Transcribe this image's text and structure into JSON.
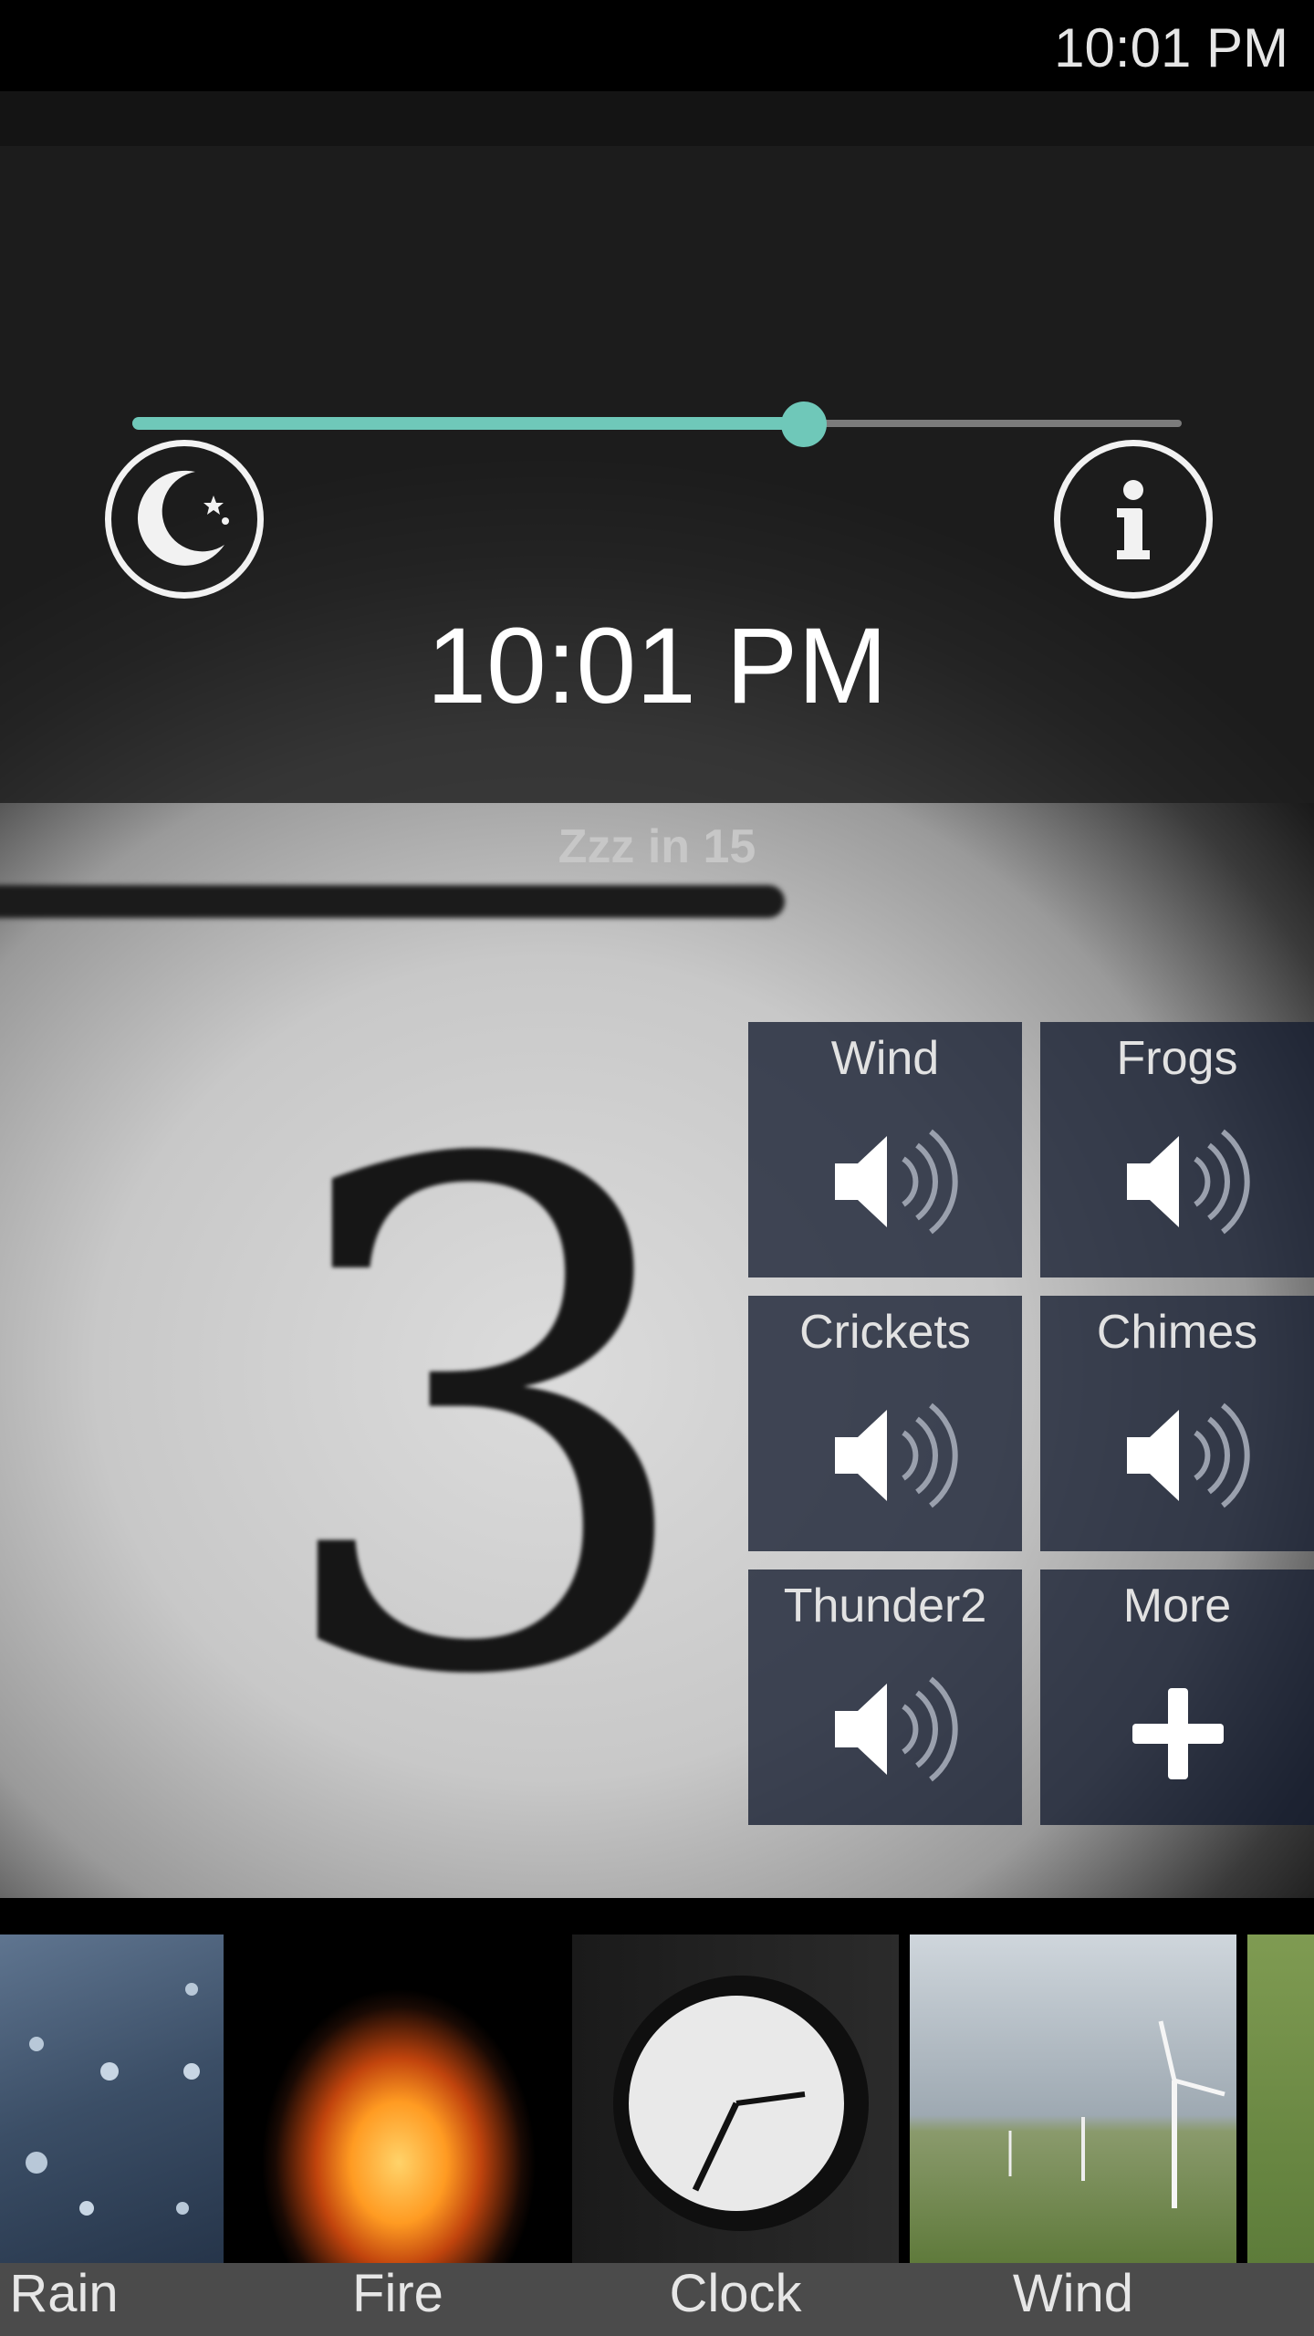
{
  "status_bar": {
    "time": "10:01 PM"
  },
  "header": {
    "slider_value": 0.64,
    "time": "10:01 PM",
    "sleep_text": "Zzz in 15",
    "moon_icon": "moon-stars-icon",
    "info_icon": "info-icon"
  },
  "tiles": [
    {
      "label": "Wind",
      "icon": "speaker-icon"
    },
    {
      "label": "Frogs",
      "icon": "speaker-icon"
    },
    {
      "label": "Crickets",
      "icon": "speaker-icon"
    },
    {
      "label": "Chimes",
      "icon": "speaker-icon"
    },
    {
      "label": "Thunder2",
      "icon": "speaker-icon"
    },
    {
      "label": "More",
      "icon": "plus-icon"
    }
  ],
  "scenes": [
    {
      "label": "Rain"
    },
    {
      "label": "Fire"
    },
    {
      "label": "Clock"
    },
    {
      "label": "Wind"
    }
  ],
  "colors": {
    "accent": "#6fc8b9",
    "tile_bg": "#1c2438"
  }
}
